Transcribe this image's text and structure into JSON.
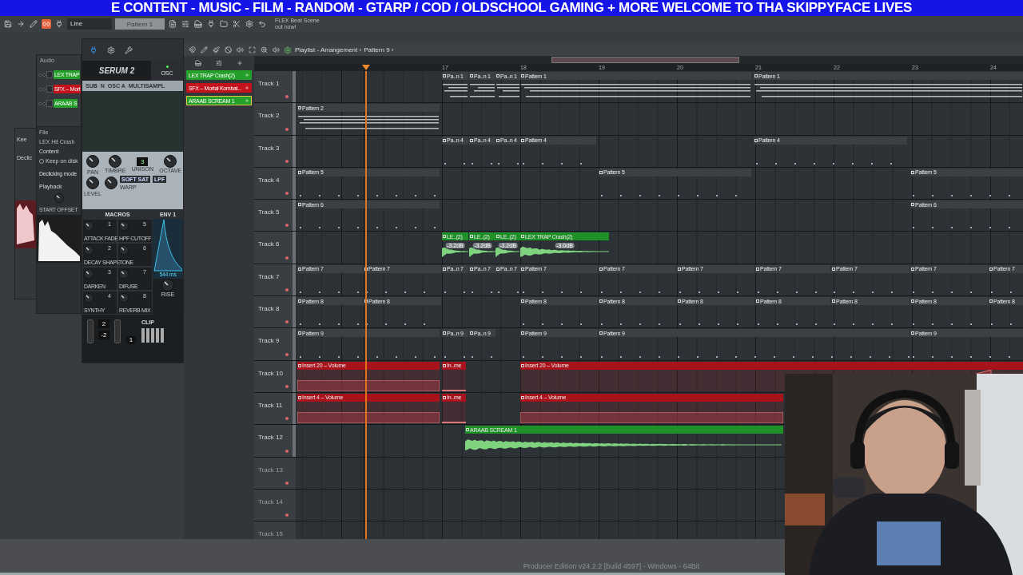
{
  "banner": {
    "text": "E CONTENT - MUSIC - FILM - RANDOM - GTARP / COD / OLDSCHOOL GAMING + MORE  WELCOME TO THA SKIPPYFACE LIVES"
  },
  "toolbar": {
    "snap": "Line",
    "pattern": "Pattern 1",
    "hint_lines": [
      "FLEX Beat Scene",
      "out now!"
    ]
  },
  "channel_rack": {
    "title": "Audio",
    "channels": [
      {
        "name": "LEX TRAP",
        "color": "#24a02a"
      },
      {
        "name": "SFX – Mort",
        "color": "#c4121c"
      },
      {
        "name": "ARAAB S",
        "color": "#24a02a"
      }
    ]
  },
  "back_window": {
    "labels": [
      "Kee",
      "Declic"
    ]
  },
  "sample_window": {
    "file_label": "File",
    "file": "LEX Hit Crash",
    "content": "Content",
    "keep": "Keep on disk",
    "keep_selected": false,
    "declick": "Declicking mode",
    "playback": "Playback",
    "offset": "START OFFSET"
  },
  "serum": {
    "logo": "SERUM 2",
    "tab": "OSC",
    "osc_labels": [
      "SUB",
      "N",
      "OSC A",
      "MULTISAMPL"
    ],
    "knobs": [
      "PAN",
      "LEVEL",
      "TIMBRE",
      "UNISON",
      "OCTAVE"
    ],
    "unison": "3",
    "filter": [
      "SOFT SAT",
      "LPF"
    ],
    "warp": "WARP",
    "macros_title": "MACROS",
    "macros": [
      {
        "num": "1",
        "label": "ATTACK FADE"
      },
      {
        "num": "5",
        "label": "HPF CUTOFF"
      },
      {
        "num": "2",
        "label": "DECAY SHAPE"
      },
      {
        "num": "6",
        "label": "TONE"
      },
      {
        "num": "3",
        "label": "DARKEN"
      },
      {
        "num": "7",
        "label": "DIFUSE"
      },
      {
        "num": "4",
        "label": "SYNTHY"
      },
      {
        "num": "8",
        "label": "REVERB MIX"
      }
    ],
    "env_title": "ENV 1",
    "env_time": "544 ms",
    "env_knob": "RISE",
    "clip": "CLIP",
    "octave_values": [
      "2",
      "-2"
    ],
    "voice": "1"
  },
  "picker": {
    "items": [
      {
        "name": "LEX TRAP Crash(2)",
        "color": "#24a02a",
        "selected": false
      },
      {
        "name": "SFX – Mortal Kombat...",
        "color": "#c4121c",
        "selected": false
      },
      {
        "name": "ARAAB SCREAM 1",
        "color": "#24a02a",
        "selected": true
      }
    ]
  },
  "playlist": {
    "title": "Playlist - Arrangement ›",
    "pattern": "Pattern 9 ›",
    "bars": [
      "17",
      "18",
      "19",
      "20",
      "21",
      "22",
      "23",
      "24"
    ],
    "tracks": [
      {
        "name": "Track 1",
        "clips": [
          {
            "label": "Pa..n 1",
            "kind": "pattern"
          },
          {
            "label": "Pa..n 1",
            "kind": "pattern"
          },
          {
            "label": "Pa..n 1",
            "kind": "pattern"
          },
          {
            "label": "Pattern 1",
            "kind": "pattern"
          },
          {
            "label": "Pattern 1",
            "kind": "pattern"
          }
        ]
      },
      {
        "name": "Track 2",
        "clips": [
          {
            "label": "Pattern 2",
            "kind": "pattern"
          }
        ]
      },
      {
        "name": "Track 3",
        "clips": [
          {
            "label": "Pa..n 4",
            "kind": "pattern"
          },
          {
            "label": "Pa..n 4",
            "kind": "pattern"
          },
          {
            "label": "Pa..n 4",
            "kind": "pattern"
          },
          {
            "label": "Pattern 4",
            "kind": "pattern"
          },
          {
            "label": "Pattern 4",
            "kind": "pattern"
          }
        ]
      },
      {
        "name": "Track 4",
        "clips": [
          {
            "label": "Pattern 5",
            "kind": "pattern"
          },
          {
            "label": "Pattern 5",
            "kind": "pattern"
          },
          {
            "label": "Pattern 5",
            "kind": "pattern"
          }
        ]
      },
      {
        "name": "Track 5",
        "clips": [
          {
            "label": "Pattern 6",
            "kind": "pattern"
          },
          {
            "label": "Pattern 6",
            "kind": "pattern"
          }
        ]
      },
      {
        "name": "Track 6",
        "clips": [
          {
            "label": "LE..(2)",
            "kind": "audio",
            "gain": "-3.2dB"
          },
          {
            "label": "LE..(2)",
            "kind": "audio",
            "gain": "-3.2dB"
          },
          {
            "label": "LE..(2)",
            "kind": "audio",
            "gain": "-3.2dB"
          },
          {
            "label": "LEX TRAP Crash(2)",
            "kind": "audio",
            "gain": "-3.0dB"
          }
        ]
      },
      {
        "name": "Track 7",
        "clips": [
          {
            "label": "Pattern 7",
            "kind": "pattern"
          },
          {
            "label": "Pattern 7",
            "kind": "pattern"
          },
          {
            "label": "Pa..n 7",
            "kind": "pattern"
          },
          {
            "label": "Pa..n 7",
            "kind": "pattern"
          },
          {
            "label": "Pa..n 7",
            "kind": "pattern"
          },
          {
            "label": "Pattern 7",
            "kind": "pattern"
          },
          {
            "label": "Pattern 7",
            "kind": "pattern"
          },
          {
            "label": "Pattern 7",
            "kind": "pattern"
          },
          {
            "label": "Pattern 7",
            "kind": "pattern"
          },
          {
            "label": "Pattern 7",
            "kind": "pattern"
          },
          {
            "label": "Pattern 7",
            "kind": "pattern"
          },
          {
            "label": "Pattern 7",
            "kind": "pattern"
          }
        ]
      },
      {
        "name": "Track 8",
        "clips": [
          {
            "label": "Pattern 8",
            "kind": "pattern"
          },
          {
            "label": "Pattern 8",
            "kind": "pattern"
          },
          {
            "label": "Pattern 8",
            "kind": "pattern"
          },
          {
            "label": "Pattern 8",
            "kind": "pattern"
          },
          {
            "label": "Pattern 8",
            "kind": "pattern"
          },
          {
            "label": "Pattern 8",
            "kind": "pattern"
          },
          {
            "label": "Pattern 8",
            "kind": "pattern"
          },
          {
            "label": "Pattern 8",
            "kind": "pattern"
          },
          {
            "label": "Pattern 8",
            "kind": "pattern"
          }
        ]
      },
      {
        "name": "Track 9",
        "clips": [
          {
            "label": "Pattern 9",
            "kind": "pattern"
          },
          {
            "label": "Pa..n 9",
            "kind": "pattern"
          },
          {
            "label": "Pa..n 9",
            "kind": "pattern"
          },
          {
            "label": "Pattern 9",
            "kind": "pattern"
          },
          {
            "label": "Pattern 9",
            "kind": "pattern"
          },
          {
            "label": "Pattern 9",
            "kind": "pattern"
          }
        ]
      },
      {
        "name": "Track 10",
        "clips": [
          {
            "label": "Insert 20 – Volume",
            "kind": "automation"
          },
          {
            "label": "In..me",
            "kind": "automation"
          },
          {
            "label": "Insert 20 – Volume",
            "kind": "automation"
          }
        ]
      },
      {
        "name": "Track 11",
        "clips": [
          {
            "label": "Insert 4 – Volume",
            "kind": "automation"
          },
          {
            "label": "In..me",
            "kind": "automation"
          },
          {
            "label": "Insert 4 – Volume",
            "kind": "automation"
          }
        ]
      },
      {
        "name": "Track 12",
        "clips": [
          {
            "label": "ARAAB SCREAM 1",
            "kind": "audio"
          }
        ]
      },
      {
        "name": "Track 13"
      },
      {
        "name": "Track 14"
      },
      {
        "name": "Track 15"
      }
    ]
  },
  "status": "Producer Edition v24.2.2 [build 4597] - Windows - 64Bit"
}
